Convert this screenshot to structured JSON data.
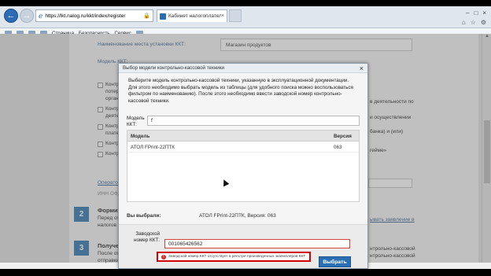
{
  "browser": {
    "url": "https://lkt.nalog.ru/kkt/index/register",
    "url_host": "lkt.nalog.ru",
    "tab_title": "Кабинет налогоплательщ...",
    "commands": [
      "Страница",
      "Безопасность",
      "Сервис"
    ]
  },
  "background": {
    "label_place": "Наименование места установки ККТ:",
    "place_value": "Магазин продуктов",
    "label_model": "Модель ККТ:",
    "text_lines": [
      "Контрольно",
      "потерей",
      "организа",
      "Контрольно",
      "деятельно",
      "Контрольно",
      "платежных",
      "Контрольно",
      "Контрольно"
    ],
    "right_lines": [
      "в деятельности по",
      "и осуществлении",
      "банка) и (или)",
      "гейме»"
    ],
    "operator_label": "Оператор",
    "inn_label": "ИНН ОФД",
    "step2_num": "2",
    "step2_title": "Формир",
    "step2_sub": [
      "Перед от",
      "налогов"
    ],
    "step2_right": "ывать заявление в",
    "step3_num": "3",
    "step3_title": "Получен",
    "step3_sub": [
      "После от",
      "отправки"
    ],
    "step3_right": [
      "нтрольно-кассовой",
      "нтрольно-кассовой"
    ]
  },
  "modal": {
    "title": "Выбор модели контрольно-кассовой техники",
    "close_glyph": "×",
    "description": "Выберите модель контрольно-кассовой техники, указанную в эксплуатационной документации. Для этого необходимо выбрать модель из таблицы (для удобного поиска можно воспользоваться фильтром по наименованию). После этого необходимо ввести заводской номер контрольно-кассовой техники.",
    "model_label": "Модель ККТ:",
    "model_filter": "f",
    "table_headers": {
      "model": "Модель",
      "version": "Версия"
    },
    "rows": [
      {
        "model": "АТОЛ FPrint-22ПТК",
        "version": "063"
      }
    ],
    "selected_label": "Вы выбрали:",
    "selected_value": "АТОЛ FPrint-22ПТК, Версия: 063",
    "serial_label": "Заводской номер ККТ:",
    "serial_value": "001065426562",
    "error_text": "Заводской номер ККТ отсутствует в реестре произведенных экземпляров ККТ",
    "choose_button": "Выбрать"
  },
  "colors": {
    "accent": "#2a6fb4",
    "error": "#d40000"
  }
}
